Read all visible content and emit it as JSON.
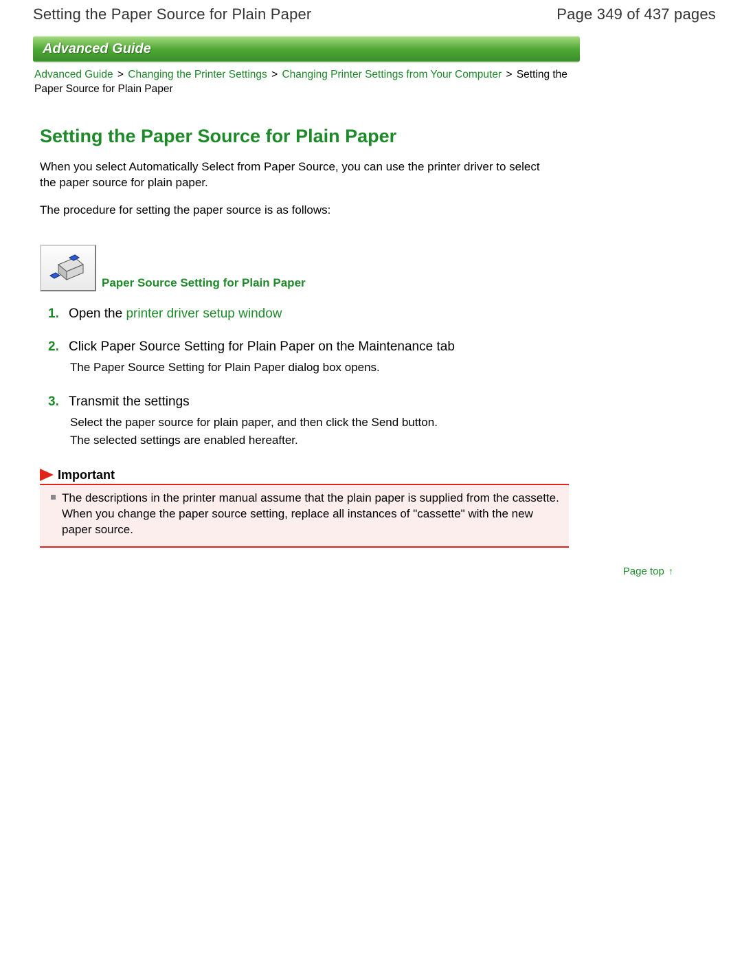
{
  "header": {
    "title": "Setting the Paper Source for Plain Paper",
    "page_indicator": "Page 349 of 437 pages"
  },
  "banner": {
    "label": "Advanced Guide"
  },
  "breadcrumbs": {
    "items": [
      {
        "label": "Advanced Guide",
        "link": true
      },
      {
        "label": "Changing the Printer Settings",
        "link": true
      },
      {
        "label": "Changing Printer Settings from Your Computer",
        "link": true
      },
      {
        "label": "Setting the Paper Source for Plain Paper",
        "link": false
      }
    ],
    "separator": ">"
  },
  "main": {
    "title": "Setting the Paper Source for Plain Paper",
    "intro1": "When you select Automatically Select from Paper Source, you can use the printer driver to select the paper source for plain paper.",
    "intro2": "The procedure for setting the paper source is as follows:",
    "section_label": "Paper Source Setting for Plain Paper"
  },
  "steps": [
    {
      "num": "1",
      "title_prefix": "Open the ",
      "title_link": "printer driver setup window",
      "body": ""
    },
    {
      "num": "2",
      "title_prefix": "Click Paper Source Setting for Plain Paper on the Maintenance tab",
      "title_link": "",
      "body": "The Paper Source Setting for Plain Paper dialog box opens."
    },
    {
      "num": "3",
      "title_prefix": "Transmit the settings",
      "title_link": "",
      "body": "Select the paper source for plain paper, and then click the Send button.\nThe selected settings are enabled hereafter."
    }
  ],
  "important": {
    "label": "Important",
    "text": "The descriptions in the printer manual assume that the plain paper is supplied from the cassette. When you change the paper source setting, replace all instances of \"cassette\" with the new paper source."
  },
  "footer": {
    "page_top": "Page top"
  }
}
